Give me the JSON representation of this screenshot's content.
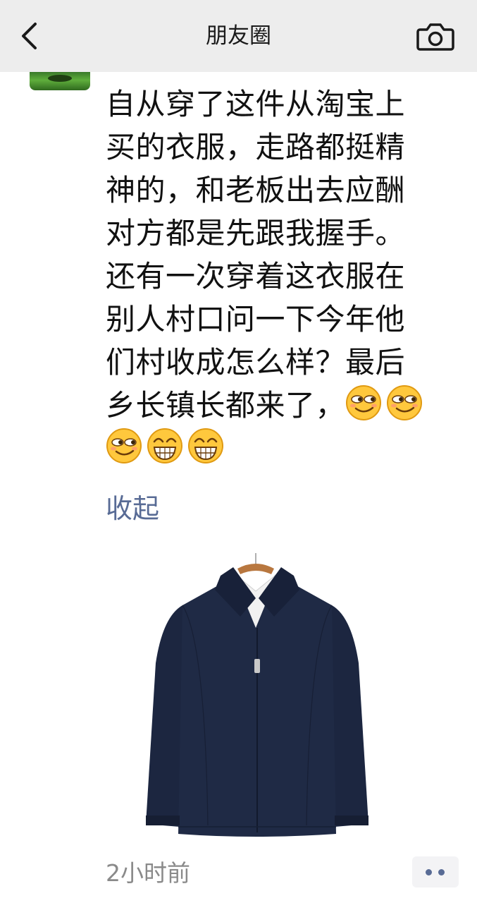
{
  "header": {
    "title": "朋友圈",
    "back_icon": "chevron-left-icon",
    "camera_icon": "camera-icon"
  },
  "post": {
    "lines": [
      "自从穿了这件从淘宝上",
      "买的衣服，走路都挺精",
      "神的，和老板出去应酬",
      "对方都是先跟我握手。",
      "还有一次穿着这衣服在",
      "别人村口问一下今年他",
      "们村收成怎么样？最后",
      "乡长镇长都来了，"
    ],
    "emojis": [
      "smirk-emoji",
      "smirk-emoji",
      "smirk-emoji",
      "grin-emoji",
      "grin-emoji"
    ],
    "collapse_label": "收起",
    "image_subject": "navy-jacket-image",
    "timestamp": "2小时前"
  },
  "colors": {
    "nav_bg": "#ededed",
    "link": "#586b95",
    "text": "#111111",
    "muted": "#8a8a8a",
    "jacket": "#1f2a45"
  }
}
